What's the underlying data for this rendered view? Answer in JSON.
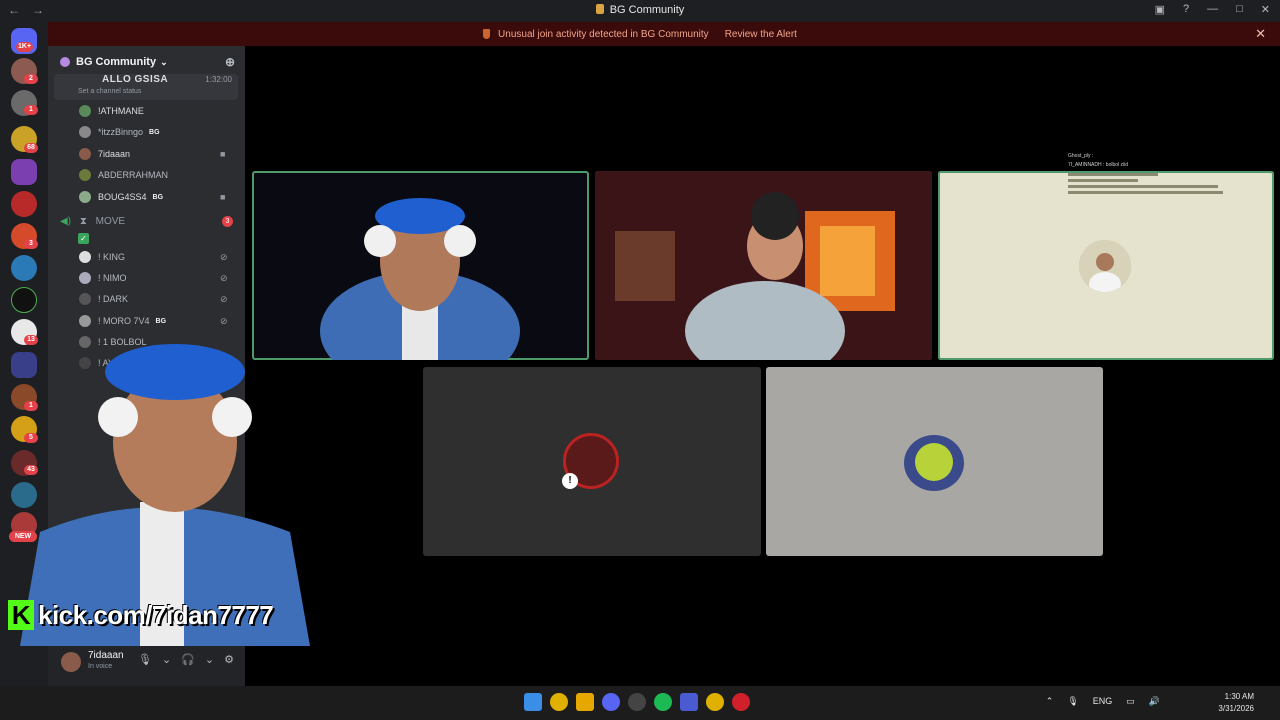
{
  "window": {
    "title": "BG Community"
  },
  "alert": {
    "message": "Unusual join activity detected in BG Community",
    "action": "Review the Alert"
  },
  "rail": {
    "top_badge": "1K+",
    "badges": [
      "2",
      "1",
      "68",
      "3",
      "13",
      "1",
      "5",
      "43"
    ],
    "new_label": "NEW"
  },
  "server": {
    "name": "BG Community"
  },
  "voice_channel": {
    "name": "ALLO GSISA",
    "status": "Set a channel status",
    "time": "1:32:00"
  },
  "members": [
    {
      "name": "!ATHMANE",
      "tag": ""
    },
    {
      "name": "*itzzBinngo",
      "tag": "BG"
    },
    {
      "name": "7idaaan",
      "tag": ""
    },
    {
      "name": "ABDERRAHMAN",
      "tag": ""
    },
    {
      "name": "BOUG4SS4",
      "tag": "BG"
    }
  ],
  "move_channel": {
    "name": "MOVE",
    "count": "3"
  },
  "move_members": [
    {
      "name": "! KING",
      "tag": ""
    },
    {
      "name": "! NIMO",
      "tag": ""
    },
    {
      "name": "! DARK",
      "tag": ""
    },
    {
      "name": "! MORO 7V4",
      "tag": "BG"
    },
    {
      "name": "! 1 BOLBOL",
      "tag": ""
    },
    {
      "name": "! AYo",
      "tag": ""
    }
  ],
  "user": {
    "name": "7idaaan",
    "status": "In voice"
  },
  "overlay": {
    "kick_url": "kick.com/7idan7777"
  },
  "chat_overlay": {
    "lines": [
      "Ghost_ply : ",
      "7I_AMINNADH : bolbol ziid"
    ]
  },
  "taskbar": {
    "lang": "ENG",
    "time": "1:30 AM",
    "date": "3/31/2026"
  }
}
